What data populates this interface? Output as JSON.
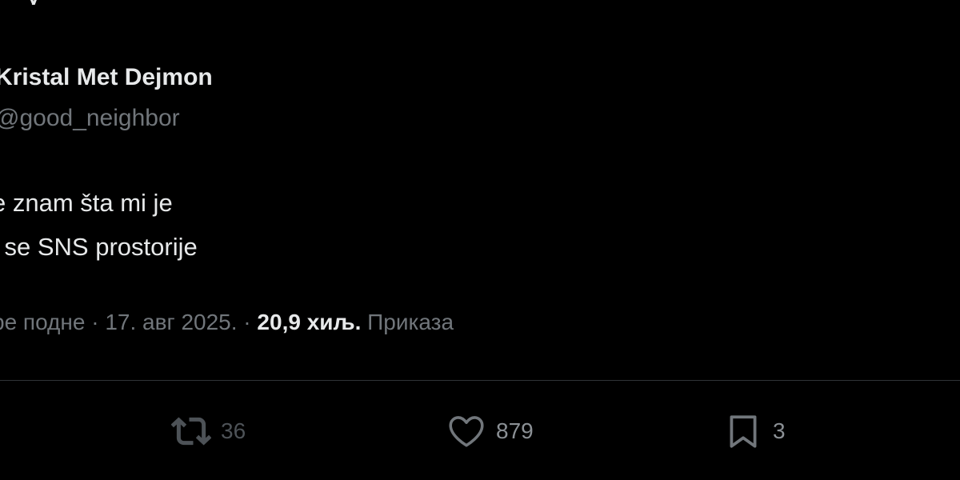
{
  "header": {
    "partial_text": "y"
  },
  "author": {
    "display_name": "Kristal Met Dejmon",
    "handle": "@good_neighbor"
  },
  "tweet": {
    "lines": [
      "e znam šta mi je",
      "i se SNS prostorije"
    ]
  },
  "meta": {
    "time": "ре подне",
    "separator1": " · ",
    "date": "17. авг 2025.",
    "separator2": " · ",
    "views_count": "20,9 хиљ.",
    "views_label": " Приказа"
  },
  "actions": {
    "retweet": {
      "icon": "retweet-icon",
      "count": "36"
    },
    "like": {
      "icon": "heart-icon",
      "count": "879"
    },
    "bookmark": {
      "icon": "bookmark-icon",
      "count": "3"
    }
  },
  "colors": {
    "background": "#000000",
    "primary_text": "#e7e9ea",
    "secondary_text": "#71767b",
    "divider": "#2f3336"
  }
}
